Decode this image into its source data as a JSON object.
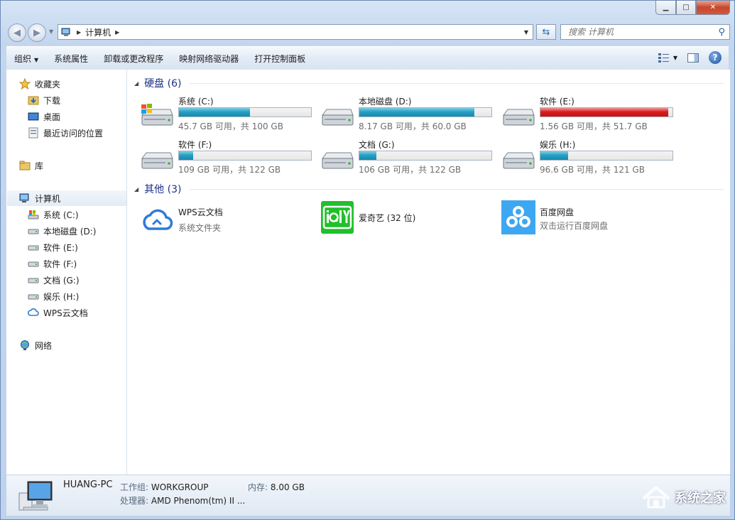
{
  "window": {
    "minimize": "▁",
    "maximize": "□",
    "close": "✕"
  },
  "address": {
    "crumb": "计算机"
  },
  "search": {
    "placeholder": "搜索 计算机"
  },
  "toolbar": {
    "organize": "组织",
    "system_properties": "系统属性",
    "uninstall": "卸载或更改程序",
    "map_drive": "映射网络驱动器",
    "control_panel": "打开控制面板"
  },
  "sidebar": {
    "favorites": "收藏夹",
    "downloads": "下载",
    "desktop": "桌面",
    "recent": "最近访问的位置",
    "libraries": "库",
    "computer": "计算机",
    "drives": [
      "系统 (C:)",
      "本地磁盘 (D:)",
      "软件 (E:)",
      "软件 (F:)",
      "文档 (G:)",
      "娱乐 (H:)"
    ],
    "wps": "WPS云文档",
    "network": "网络"
  },
  "hard_disks": {
    "title": "硬盘 (6)",
    "drives": [
      {
        "name": "系统 (C:)",
        "free": "45.7 GB 可用，共 100 GB",
        "used_percent": 54,
        "status": "normal",
        "icon": "windows-drive-icon"
      },
      {
        "name": "本地磁盘 (D:)",
        "free": "8.17 GB 可用，共 60.0 GB",
        "used_percent": 87,
        "status": "normal",
        "icon": "hard-drive-icon"
      },
      {
        "name": "软件 (E:)",
        "free": "1.56 GB 可用，共 51.7 GB",
        "used_percent": 97,
        "status": "full",
        "icon": "hard-drive-icon"
      },
      {
        "name": "软件 (F:)",
        "free": "109 GB 可用，共 122 GB",
        "used_percent": 11,
        "status": "normal",
        "icon": "hard-drive-icon"
      },
      {
        "name": "文档 (G:)",
        "free": "106 GB 可用，共 122 GB",
        "used_percent": 13,
        "status": "normal",
        "icon": "hard-drive-icon"
      },
      {
        "name": "娱乐 (H:)",
        "free": "96.6 GB 可用，共 121 GB",
        "used_percent": 21,
        "status": "normal",
        "icon": "hard-drive-icon"
      }
    ]
  },
  "others": {
    "title": "其他 (3)",
    "items": [
      {
        "name": "WPS云文档",
        "sub": "系统文件夹",
        "icon": "wps-cloud-icon"
      },
      {
        "name": "爱奇艺 (32 位)",
        "sub": "",
        "icon": "iqiyi-icon"
      },
      {
        "name": "百度网盘",
        "sub": "双击运行百度网盘",
        "icon": "baidu-netdisk-icon"
      }
    ]
  },
  "details": {
    "pc_name": "HUANG-PC",
    "workgroup_label": "工作组:",
    "workgroup": "WORKGROUP",
    "memory_label": "内存:",
    "memory": "8.00 GB",
    "cpu_label": "处理器:",
    "cpu": "AMD Phenom(tm) II ..."
  },
  "watermark": {
    "text": "系统之家"
  },
  "colors": {
    "bar_normal": "#26a0c3",
    "bar_full": "#da1c1c",
    "header_blue": "#1e3287"
  }
}
